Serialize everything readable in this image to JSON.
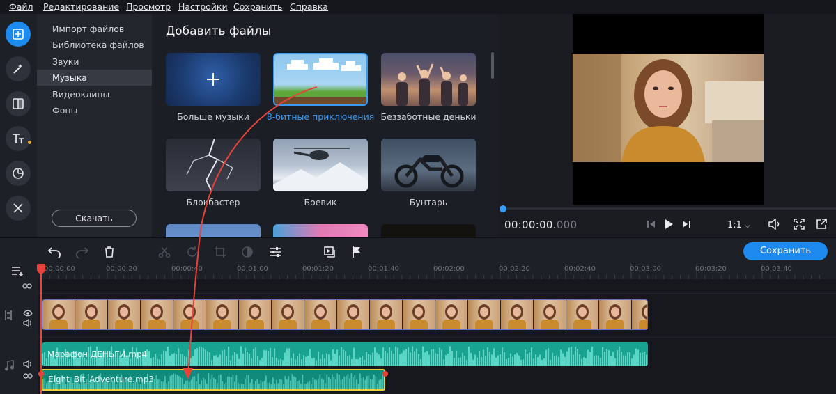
{
  "menu": [
    "Файл",
    "Редактирование",
    "Просмотр",
    "Настройки",
    "Сохранить",
    "Справка"
  ],
  "categories": {
    "items": [
      "Импорт файлов",
      "Библиотека файлов",
      "Звуки",
      "Музыка",
      "Видеоклипы",
      "Фоны"
    ],
    "selected": "Музыка",
    "download_label": "Скачать"
  },
  "gallery": {
    "title": "Добавить файлы",
    "tiles": [
      "Больше музыки",
      "8-битные приключения",
      "Беззаботные деньки",
      "Блокбастер",
      "Боевик",
      "Бунтарь"
    ],
    "selected": "8-битные приключения"
  },
  "player": {
    "timecode_main": "00:00:00.",
    "timecode_ms": "000",
    "scale": "1:1"
  },
  "timeline": {
    "save_label": "Сохранить",
    "ruler": [
      "00:00:00",
      "00:00:20",
      "00:00:40",
      "00:01:00",
      "00:01:20",
      "00:01:40",
      "00:02:00",
      "00:02:20",
      "00:02:40",
      "00:03:00",
      "00:03:20",
      "00:03:40"
    ],
    "audio_clip": "Марафон ДЕНЬГИ.mp4",
    "music_clip": "Eight_Bit_Adventure.mp3"
  },
  "colors": {
    "accent": "#1d8af0",
    "playhead": "#e8433b",
    "audio": "#17a390",
    "selection": "#f2d23c"
  }
}
